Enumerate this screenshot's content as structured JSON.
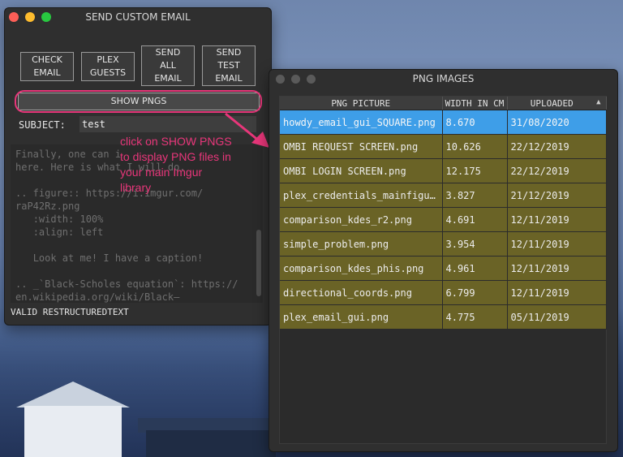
{
  "window1": {
    "title": "SEND CUSTOM EMAIL",
    "buttons": {
      "check_email": "CHECK\nEMAIL",
      "plex_guests": "PLEX\nGUESTS",
      "send_all_email": "SEND\nALL\nEMAIL",
      "send_test_email": "SEND\nTEST\nEMAIL",
      "show_pngs": "SHOW PNGS"
    },
    "subject_label": "SUBJECT:",
    "subject_value": "test",
    "body_text": "Finally, one can i\nhere. Here is what I will do.\n\n.. figure:: https://i.imgur.com/\nraP42Rz.png\n   :width: 100%\n   :align: left\n\n   Look at me! I have a caption!\n\n.. _`Black-Scholes equation`: https://\nen.wikipedia.org/wiki/Black—\nScholes_equation",
    "status": "VALID RESTRUCTUREDTEXT"
  },
  "annotation": "click on SHOW PNGS\nto display PNG files in\nyour main Imgur\nlibrary",
  "window2": {
    "title": "PNG IMAGES",
    "columns": [
      "PNG PICTURE",
      "WIDTH IN CM",
      "UPLOADED"
    ],
    "rows": [
      {
        "name": "howdy_email_gui_SQUARE.png",
        "width": "8.670",
        "uploaded": "31/08/2020"
      },
      {
        "name": "OMBI REQUEST SCREEN.png",
        "width": "10.626",
        "uploaded": "22/12/2019"
      },
      {
        "name": "OMBI LOGIN SCREEN.png",
        "width": "12.175",
        "uploaded": "22/12/2019"
      },
      {
        "name": "plex_credentials_mainfigur…",
        "width": "3.827",
        "uploaded": "21/12/2019"
      },
      {
        "name": "comparison_kdes_r2.png",
        "width": "4.691",
        "uploaded": "12/11/2019"
      },
      {
        "name": "simple_problem.png",
        "width": "3.954",
        "uploaded": "12/11/2019"
      },
      {
        "name": "comparison_kdes_phis.png",
        "width": "4.961",
        "uploaded": "12/11/2019"
      },
      {
        "name": "directional_coords.png",
        "width": "6.799",
        "uploaded": "12/11/2019"
      },
      {
        "name": "plex_email_gui.png",
        "width": "4.775",
        "uploaded": "05/11/2019"
      }
    ]
  },
  "colors": {
    "accent_pink": "#e8367a",
    "row_selected": "#3e9ee8",
    "row_olive": "#6a6326"
  }
}
